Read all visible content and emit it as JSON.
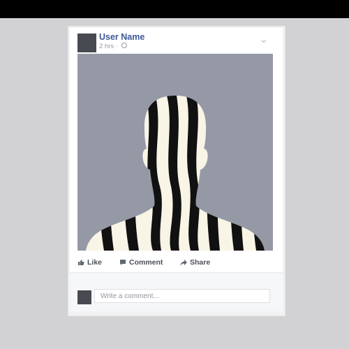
{
  "post": {
    "author": "User Name",
    "time": "2 hrs",
    "separator": "·",
    "actions": {
      "like": "Like",
      "comment": "Comment",
      "share": "Share"
    }
  },
  "comment_box": {
    "placeholder": "Write a comment..."
  },
  "icons": [
    "chevron-down-icon",
    "globe-icon",
    "like-icon",
    "comment-icon",
    "share-icon"
  ],
  "colors": {
    "accent": "#3b5998",
    "photo_bg": "#9599a6",
    "avatar": "#474a51",
    "topbar": "#000000",
    "page_bg": "#d2d2d4"
  }
}
